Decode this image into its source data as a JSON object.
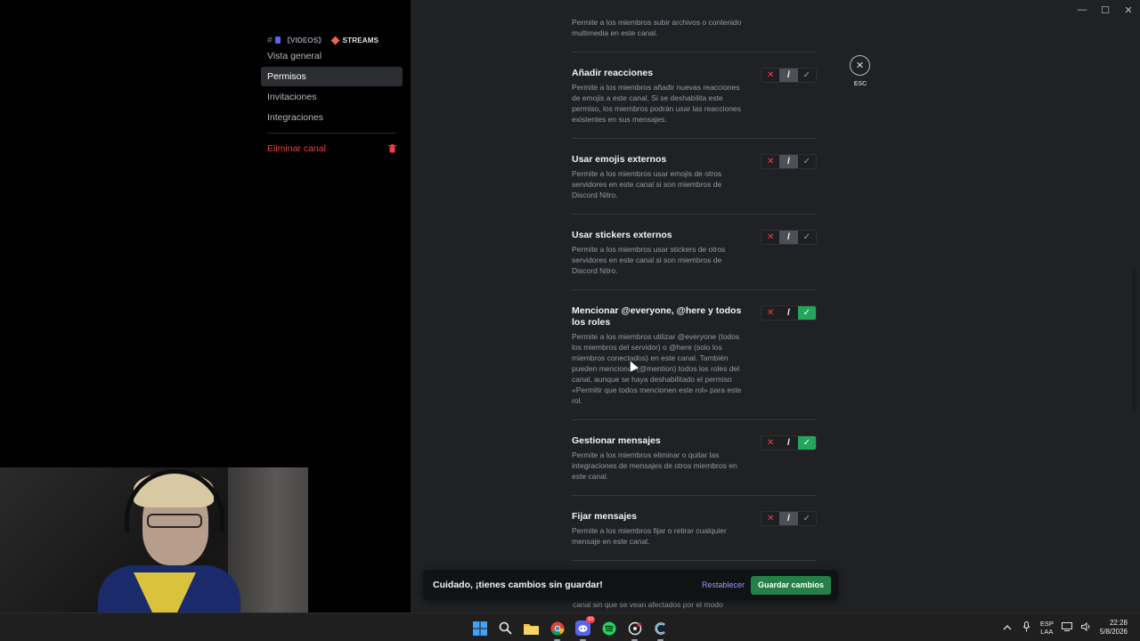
{
  "window": {
    "minimize": "—",
    "maximize": "☐",
    "close": "✕"
  },
  "sidebar": {
    "channel": {
      "hash": "#",
      "video_tag": "〘VIDEOS〙",
      "streams": "STREAMS"
    },
    "items": [
      {
        "label": "Vista general"
      },
      {
        "label": "Permisos"
      },
      {
        "label": "Invitaciones"
      },
      {
        "label": "Integraciones"
      }
    ],
    "delete_label": "Eliminar canal"
  },
  "permissions": [
    {
      "title": "",
      "desc": "Permite a los miembros subir archivos o contenido multimedia en este canal.",
      "state": "none"
    },
    {
      "title": "Añadir reacciones",
      "desc": "Permite a los miembros añadir nuevas reacciones de emojis a este canal. Si se deshabilita este permiso, los miembros podrán usar las reacciones existentes en sus mensajes.",
      "state": "neutral"
    },
    {
      "title": "Usar emojis externos",
      "desc": "Permite a los miembros usar emojis de otros servidores en este canal si son miembros de Discord Nitro.",
      "state": "neutral"
    },
    {
      "title": "Usar stickers externos",
      "desc": "Permite a los miembros usar stickers de otros servidores en este canal si son miembros de Discord Nitro.",
      "state": "neutral"
    },
    {
      "title": "Mencionar @everyone, @here y todos los roles",
      "desc": "Permite a los miembros utilizar @everyone (todos los miembros del servidor) o @here (solo los miembros conectados) en este canal. También pueden mencionar (@mention) todos los roles del canal, aunque se haya deshabilitado el permiso «Permitir que todos mencionen este rol» para este rol.",
      "state": "allow"
    },
    {
      "title": "Gestionar mensajes",
      "desc": "Permite a los miembros eliminar o quitar las integraciones de mensajes de otros miembros en este canal.",
      "state": "allow"
    },
    {
      "title": "Fijar mensajes",
      "desc": "Permite a los miembros fijar o retirar cualquier mensaje en este canal.",
      "state": "neutral"
    }
  ],
  "toggle": {
    "deny": "✕",
    "neutral": "/",
    "allow": "✓"
  },
  "esc": {
    "icon": "✕",
    "label": "ESC"
  },
  "notice": {
    "text": "Cuidado, ¡tienes cambios sin guardar!",
    "reset": "Restablecer",
    "save": "Guardar cambios"
  },
  "under_text": "canal sin que se vean afectados por el modo",
  "taskbar": {
    "discord_badge": "10",
    "lang_top": "ESP",
    "lang_bottom": "LAA",
    "time": "22:28",
    "date": "5/8/2026"
  },
  "colors": {
    "allow": "#23a55a",
    "deny": "#f23f43",
    "save": "#248046",
    "link": "#949cf7"
  }
}
